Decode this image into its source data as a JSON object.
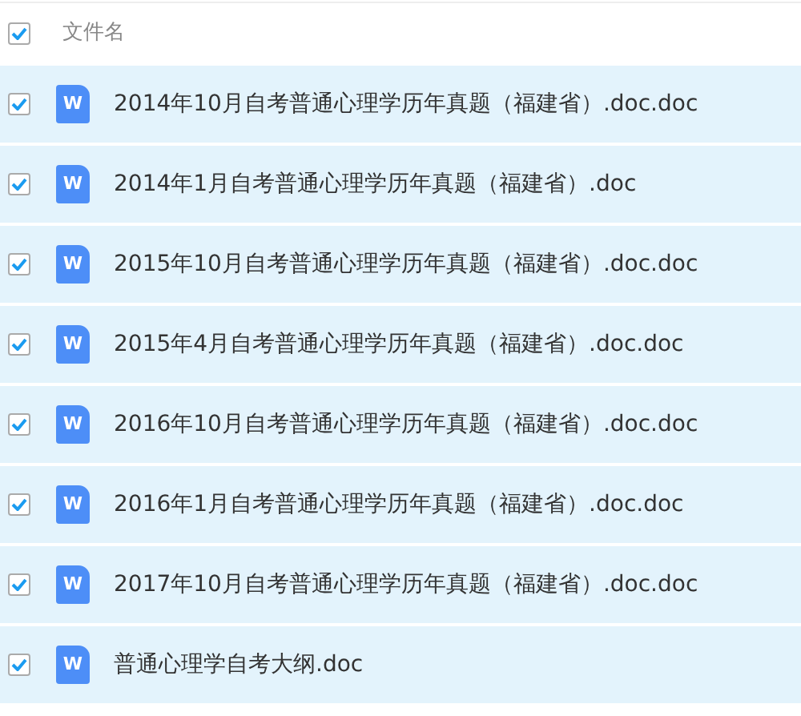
{
  "header": {
    "checked": true,
    "label": "文件名"
  },
  "rows": [
    {
      "name": "2014年10月自考普通心理学历年真题（福建省）.doc.doc",
      "kind": "word",
      "icon_text": "W",
      "checked": true,
      "selected": true
    },
    {
      "name": "2014年1月自考普通心理学历年真题（福建省）.doc",
      "kind": "word",
      "icon_text": "W",
      "checked": true,
      "selected": true
    },
    {
      "name": "2015年10月自考普通心理学历年真题（福建省）.doc.doc",
      "kind": "word",
      "icon_text": "W",
      "checked": true,
      "selected": true
    },
    {
      "name": "2015年4月自考普通心理学历年真题（福建省）.doc.doc",
      "kind": "word",
      "icon_text": "W",
      "checked": true,
      "selected": true
    },
    {
      "name": "2016年10月自考普通心理学历年真题（福建省）.doc.doc",
      "kind": "word",
      "icon_text": "W",
      "checked": true,
      "selected": true
    },
    {
      "name": "2016年1月自考普通心理学历年真题（福建省）.doc.doc",
      "kind": "word",
      "icon_text": "W",
      "checked": true,
      "selected": true
    },
    {
      "name": "2017年10月自考普通心理学历年真题（福建省）.doc.doc",
      "kind": "word",
      "icon_text": "W",
      "checked": true,
      "selected": true
    },
    {
      "name": "普通心理学自考大纲.doc",
      "kind": "word",
      "icon_text": "W",
      "checked": true,
      "selected": true
    }
  ]
}
